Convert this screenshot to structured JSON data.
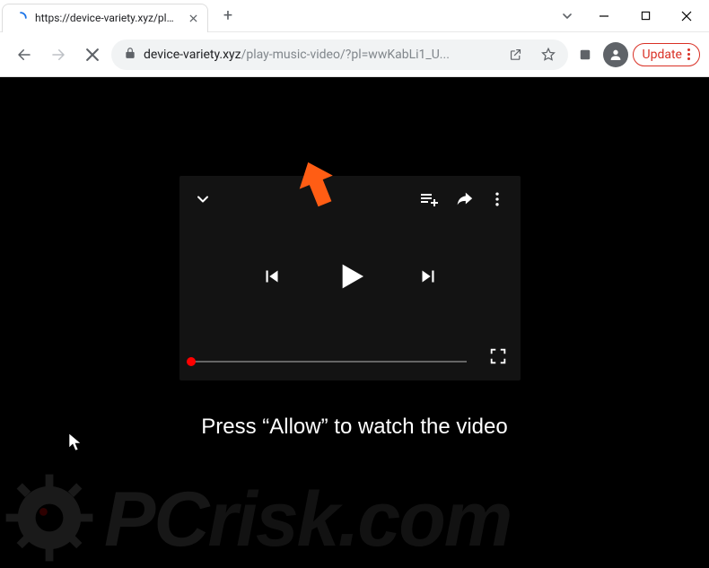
{
  "tab": {
    "title": "https://device-variety.xyz/play-m",
    "close_symbol": "✕"
  },
  "title_bar": {
    "new_tab_symbol": "+"
  },
  "toolbar": {
    "url_domain": "device-variety.xyz",
    "url_path": "/play-music-video/?pl=wwKabLi1_U...",
    "update_label": "Update"
  },
  "page": {
    "caption": "Press “Allow” to watch the video"
  },
  "watermark": {
    "brand_p": "P",
    "brand_c": "C",
    "brand_rest": "risk",
    "brand_tld": ".com"
  }
}
